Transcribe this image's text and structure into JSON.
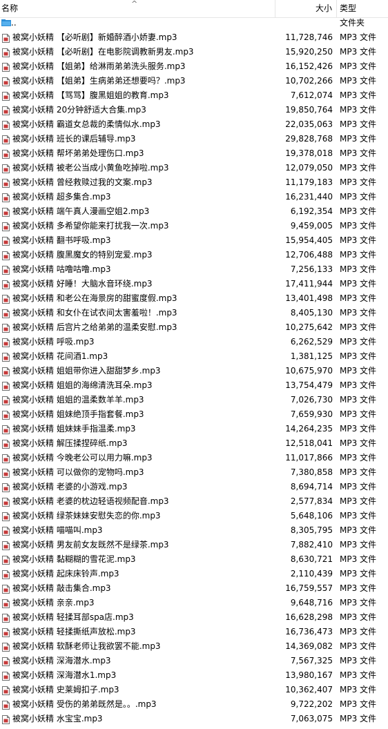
{
  "header": {
    "name_label": "名称",
    "sort_arrow": "^",
    "size_label": "大小",
    "type_label": "类型"
  },
  "parent_row": {
    "name": "..",
    "type": "文件夹"
  },
  "files": [
    {
      "name": "被窝小妖精 【必听剧】新婚醉酒小娇妻.mp3",
      "size": "11,728,746",
      "type": "MP3 文件"
    },
    {
      "name": "被窝小妖精 【必听剧】在电影院调教新男友.mp3",
      "size": "15,920,250",
      "type": "MP3 文件"
    },
    {
      "name": "被窝小妖精 【姐弟】给淋雨弟弟洗头服务.mp3",
      "size": "16,152,426",
      "type": "MP3 文件"
    },
    {
      "name": "被窝小妖精 【姐弟】生病弟弟还想要吗？.mp3",
      "size": "10,702,266",
      "type": "MP3 文件"
    },
    {
      "name": "被窝小妖精 【骂骂】腹黑姐姐的教育.mp3",
      "size": "7,612,074",
      "type": "MP3 文件"
    },
    {
      "name": "被窝小妖精 20分钟舒适大合集.mp3",
      "size": "19,850,764",
      "type": "MP3 文件"
    },
    {
      "name": "被窝小妖精 霸道女总裁的柔情似水.mp3",
      "size": "22,035,063",
      "type": "MP3 文件"
    },
    {
      "name": "被窝小妖精 班长的课后辅导.mp3",
      "size": "29,828,768",
      "type": "MP3 文件"
    },
    {
      "name": "被窝小妖精 帮坏弟弟处理伤口.mp3",
      "size": "19,378,018",
      "type": "MP3 文件"
    },
    {
      "name": "被窝小妖精 被老公当成小黄鱼吃掉啦.mp3",
      "size": "12,079,050",
      "type": "MP3 文件"
    },
    {
      "name": "被窝小妖精 曾经救赎过我的文案.mp3",
      "size": "11,179,183",
      "type": "MP3 文件"
    },
    {
      "name": "被窝小妖精 超多集合.mp3",
      "size": "16,231,440",
      "type": "MP3 文件"
    },
    {
      "name": "被窝小妖精 端午真人漫画空姐2.mp3",
      "size": "6,192,354",
      "type": "MP3 文件"
    },
    {
      "name": "被窝小妖精 多希望你能来打扰我一次.mp3",
      "size": "9,459,005",
      "type": "MP3 文件"
    },
    {
      "name": "被窝小妖精 翻书呼吸.mp3",
      "size": "15,954,405",
      "type": "MP3 文件"
    },
    {
      "name": "被窝小妖精 腹黑魔女的特别宠爱.mp3",
      "size": "12,706,488",
      "type": "MP3 文件"
    },
    {
      "name": "被窝小妖精 咕噜咕噜.mp3",
      "size": "7,256,133",
      "type": "MP3 文件"
    },
    {
      "name": "被窝小妖精 好睡！大脑水音环绕.mp3",
      "size": "17,411,944",
      "type": "MP3 文件"
    },
    {
      "name": "被窝小妖精 和老公在海景房的甜蜜度假.mp3",
      "size": "13,401,498",
      "type": "MP3 文件"
    },
    {
      "name": "被窝小妖精 和女仆在试衣间太害羞啦！.mp3",
      "size": "8,405,130",
      "type": "MP3 文件"
    },
    {
      "name": "被窝小妖精 后宫片之给弟弟的温柔安慰.mp3",
      "size": "10,275,642",
      "type": "MP3 文件"
    },
    {
      "name": "被窝小妖精 呼吸.mp3",
      "size": "6,262,529",
      "type": "MP3 文件"
    },
    {
      "name": "被窝小妖精 花间酒1.mp3",
      "size": "1,381,125",
      "type": "MP3 文件"
    },
    {
      "name": "被窝小妖精 姐姐带你进入甜甜梦乡.mp3",
      "size": "10,675,970",
      "type": "MP3 文件"
    },
    {
      "name": "被窝小妖精 姐姐的海绵清洗耳朵.mp3",
      "size": "13,754,479",
      "type": "MP3 文件"
    },
    {
      "name": "被窝小妖精 姐姐的温柔数羊羊.mp3",
      "size": "7,026,730",
      "type": "MP3 文件"
    },
    {
      "name": "被窝小妖精 姐妹绝顶手指套餐.mp3",
      "size": "7,659,930",
      "type": "MP3 文件"
    },
    {
      "name": "被窝小妖精 姐妹妹手指温柔.mp3",
      "size": "14,264,235",
      "type": "MP3 文件"
    },
    {
      "name": "被窝小妖精 解压揉捏碎纸.mp3",
      "size": "12,518,041",
      "type": "MP3 文件"
    },
    {
      "name": "被窝小妖精 今晚老公可以用力嘛.mp3",
      "size": "11,017,866",
      "type": "MP3 文件"
    },
    {
      "name": "被窝小妖精 可以做你的宠物吗.mp3",
      "size": "7,380,858",
      "type": "MP3 文件"
    },
    {
      "name": "被窝小妖精 老婆的小游戏.mp3",
      "size": "8,694,714",
      "type": "MP3 文件"
    },
    {
      "name": "被窝小妖精 老婆的枕边轻语视频配音.mp3",
      "size": "2,577,834",
      "type": "MP3 文件"
    },
    {
      "name": "被窝小妖精 绿茶妹妹安慰失恋的你.mp3",
      "size": "5,648,106",
      "type": "MP3 文件"
    },
    {
      "name": "被窝小妖精 喵喵叫.mp3",
      "size": "8,305,795",
      "type": "MP3 文件"
    },
    {
      "name": "被窝小妖精 男友前女友既然不是绿茶.mp3",
      "size": "7,882,410",
      "type": "MP3 文件"
    },
    {
      "name": "被窝小妖精 黏糊糊的雪花泥.mp3",
      "size": "8,630,721",
      "type": "MP3 文件"
    },
    {
      "name": "被窝小妖精 起床床铃声.mp3",
      "size": "2,110,439",
      "type": "MP3 文件"
    },
    {
      "name": "被窝小妖精 敲击集合.mp3",
      "size": "16,759,557",
      "type": "MP3 文件"
    },
    {
      "name": "被窝小妖精 亲亲.mp3",
      "size": "9,648,716",
      "type": "MP3 文件"
    },
    {
      "name": "被窝小妖精 轻揉耳部spa店.mp3",
      "size": "16,628,298",
      "type": "MP3 文件"
    },
    {
      "name": "被窝小妖精 轻揉撕纸声放松.mp3",
      "size": "16,736,473",
      "type": "MP3 文件"
    },
    {
      "name": "被窝小妖精 软酥老师让我欲罢不能.mp3",
      "size": "14,369,082",
      "type": "MP3 文件"
    },
    {
      "name": "被窝小妖精 深海潜水.mp3",
      "size": "7,567,325",
      "type": "MP3 文件"
    },
    {
      "name": "被窝小妖精 深海潜水1.mp3",
      "size": "13,980,167",
      "type": "MP3 文件"
    },
    {
      "name": "被窝小妖精 史莱姆扣子.mp3",
      "size": "10,362,407",
      "type": "MP3 文件"
    },
    {
      "name": "被窝小妖精 受伤的弟弟既然是。。.mp3",
      "size": "9,722,202",
      "type": "MP3 文件"
    },
    {
      "name": "被窝小妖精 水宝宝.mp3",
      "size": "7,063,075",
      "type": "MP3 文件"
    }
  ]
}
